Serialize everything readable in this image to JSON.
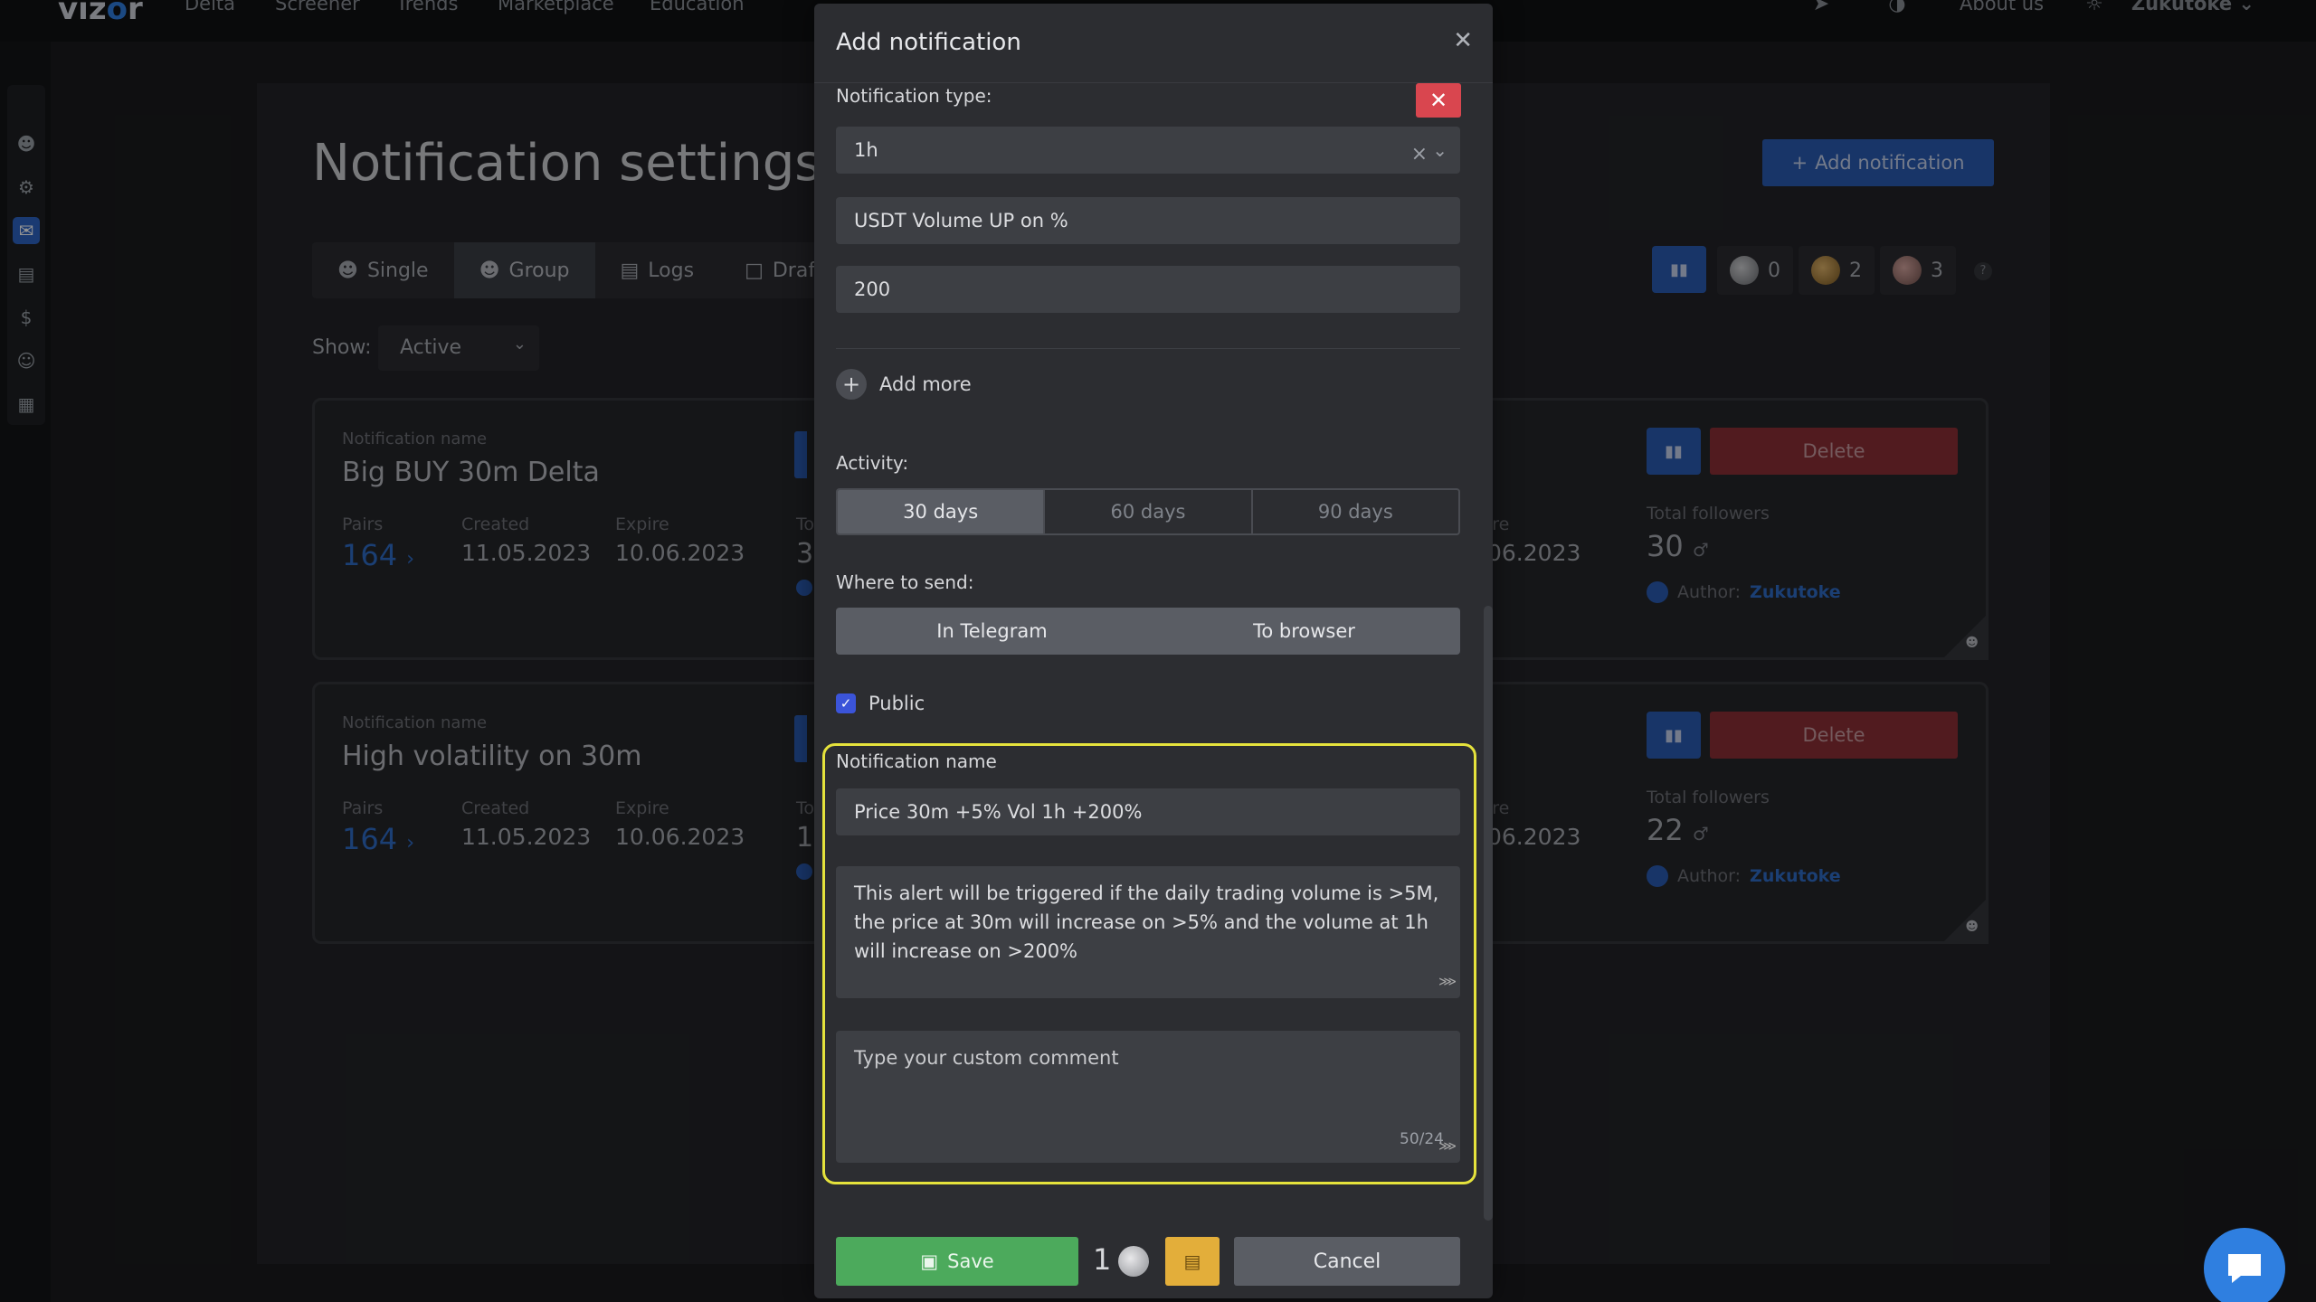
{
  "nav": {
    "logo_left": "viz",
    "logo_o": "o",
    "logo_right": "r",
    "links": [
      "Delta",
      "Screener",
      "Trends",
      "Marketplace",
      "Education"
    ],
    "about": "About us",
    "user": "Zukutoke"
  },
  "page": {
    "title": "Notification settings",
    "tabs": [
      "Single",
      "Group",
      "Logs",
      "Drafts"
    ],
    "active_tab": "Group",
    "show_label": "Show:",
    "show_value": "Active",
    "add_button": "Add notification",
    "coins": [
      "0",
      "2",
      "3"
    ],
    "help": "?"
  },
  "cards": [
    {
      "label": "Notification name",
      "name": "Big BUY 30m Delta",
      "pairs_label": "Pairs",
      "pairs": "164",
      "created_label": "Created",
      "created": "11.05.2023",
      "expire_label": "Expire",
      "expire": "10.06.2023",
      "frag_sub": "To",
      "frag_val": "3",
      "expire_right_label": "ire",
      "expire_right": "06.2023",
      "followers_label": "Total followers",
      "followers": "30",
      "author_label": "Author:",
      "author": "Zukutoke",
      "delete": "Delete"
    },
    {
      "label": "Notification name",
      "name": "High volatility on 30m",
      "pairs_label": "Pairs",
      "pairs": "164",
      "created_label": "Created",
      "created": "11.05.2023",
      "expire_label": "Expire",
      "expire": "10.06.2023",
      "frag_sub": "To",
      "frag_val": "1",
      "expire_right_label": "ire",
      "expire_right": "06.2023",
      "followers_label": "Total followers",
      "followers": "22",
      "author_label": "Author:",
      "author": "Zukutoke",
      "delete": "Delete"
    }
  ],
  "modal": {
    "title": "Add notification",
    "type_label": "Notification type:",
    "type_value": "1h",
    "condition": "USDT Volume UP on %",
    "value": "200",
    "add_more": "Add more",
    "activity_label": "Activity:",
    "activity_options": [
      "30 days",
      "60 days",
      "90 days"
    ],
    "activity_selected": "30 days",
    "send_label": "Where to send:",
    "send_options": [
      "In Telegram",
      "To browser"
    ],
    "public_label": "Public",
    "name_label": "Notification name",
    "name_value": "Price 30m +5% Vol 1h +200%",
    "description": "This alert will be triggered if the daily trading volume is >5M, the price at 30m will increase on >5% and the volume at 1h will increase on >200%",
    "comment_placeholder": "Type your custom comment",
    "comment_count": "50/24",
    "save": "Save",
    "cost": "1",
    "cancel": "Cancel"
  },
  "colors": {
    "accent_blue": "#2a5cb4",
    "save_green": "#4caa5c",
    "delete_red": "#8c2f36",
    "highlight_yellow": "#e5e23c",
    "draft_amber": "#e3ae3a"
  }
}
